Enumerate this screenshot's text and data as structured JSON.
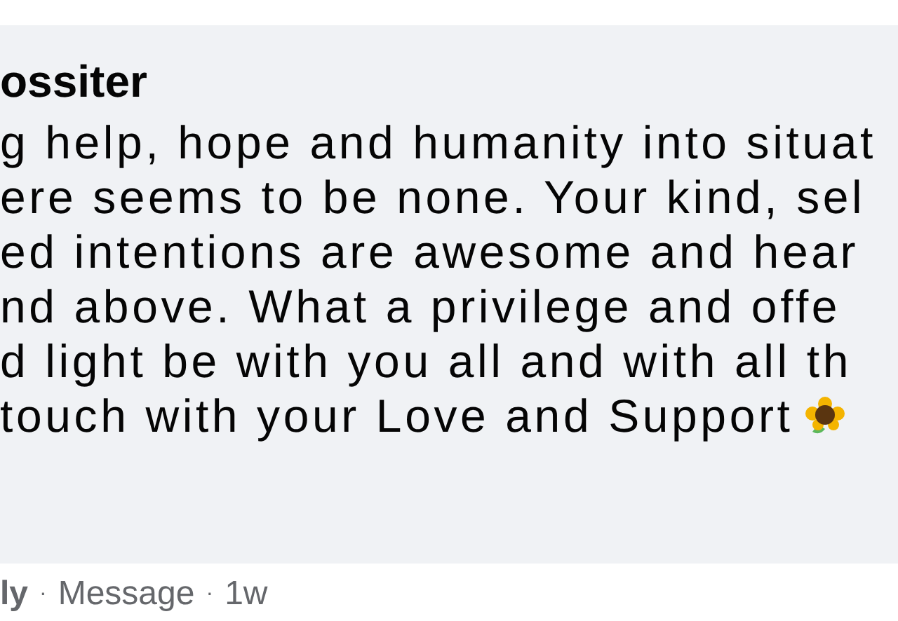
{
  "comment": {
    "author": "ossiter",
    "lines": [
      "g help, hope and humanity into situat",
      "ere seems to be none. Your kind, sel",
      "ed intentions are awesome and hear",
      "nd above. What a privilege and offe",
      "d light be with you all and with all th",
      "touch with your Love and Support"
    ],
    "trailing_icon": true
  },
  "actions": [
    {
      "kind": "link-bold",
      "label": "ly"
    },
    {
      "kind": "separator",
      "label": "·"
    },
    {
      "kind": "link",
      "label": "Message"
    },
    {
      "kind": "separator",
      "label": "·"
    },
    {
      "kind": "time",
      "label": "1w"
    }
  ]
}
